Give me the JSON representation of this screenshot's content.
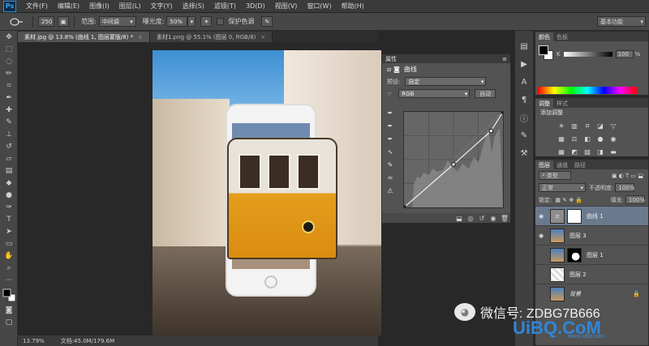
{
  "app": {
    "logo": "Ps",
    "menu": [
      "文件(F)",
      "编辑(E)",
      "图像(I)",
      "图层(L)",
      "文字(Y)",
      "选择(S)",
      "滤镜(T)",
      "3D(D)",
      "视图(V)",
      "窗口(W)",
      "帮助(H)"
    ]
  },
  "options": {
    "brush_size": "250",
    "range_label": "范围:",
    "range_value": "中间调",
    "exposure_label": "曝光度:",
    "exposure_value": "50%",
    "protect_tones": "保护色调",
    "workspace": "基本功能"
  },
  "tabs": [
    {
      "label": "素材.jpg @ 13.8% (曲线 1, 图层蒙版/8) *",
      "close": "×"
    },
    {
      "label": "素材1.png @ 55.1% (图层 0, RGB/8)",
      "close": "×"
    }
  ],
  "status": {
    "zoom": "13.79%",
    "doc": "文档:45.0M/179.6M"
  },
  "properties": {
    "header": "属性",
    "title": "曲线",
    "preset_label": "预设:",
    "preset_value": "自定",
    "channel_value": "RGB",
    "auto_label": "自动"
  },
  "color_panel": {
    "tabs": [
      "颜色",
      "色板"
    ],
    "channel": "K",
    "value": "100",
    "unit": "%"
  },
  "adjust_panel": {
    "tabs": [
      "调整",
      "样式"
    ],
    "title": "添加调整"
  },
  "layers_panel": {
    "tabs": [
      "图层",
      "通道",
      "路径"
    ],
    "kind_label": "类型",
    "blend_mode": "正常",
    "opacity_label": "不透明度:",
    "opacity_value": "100%",
    "lock_label": "锁定:",
    "fill_label": "填充:",
    "fill_value": "100%",
    "layers": [
      {
        "name": "曲线 1"
      },
      {
        "name": "图层 3"
      },
      {
        "name": "图层 1"
      },
      {
        "name": "图层 2"
      },
      {
        "name": "背景"
      }
    ]
  },
  "watermark": {
    "text": "微信号: ZDBG7B666",
    "logo": "UiBQ.CoM",
    "logo_sub": "www.uibq.com"
  },
  "curve": {
    "points": [
      [
        0,
        0
      ],
      [
        50,
        45
      ],
      [
        88,
        80
      ],
      [
        100,
        100
      ]
    ]
  }
}
